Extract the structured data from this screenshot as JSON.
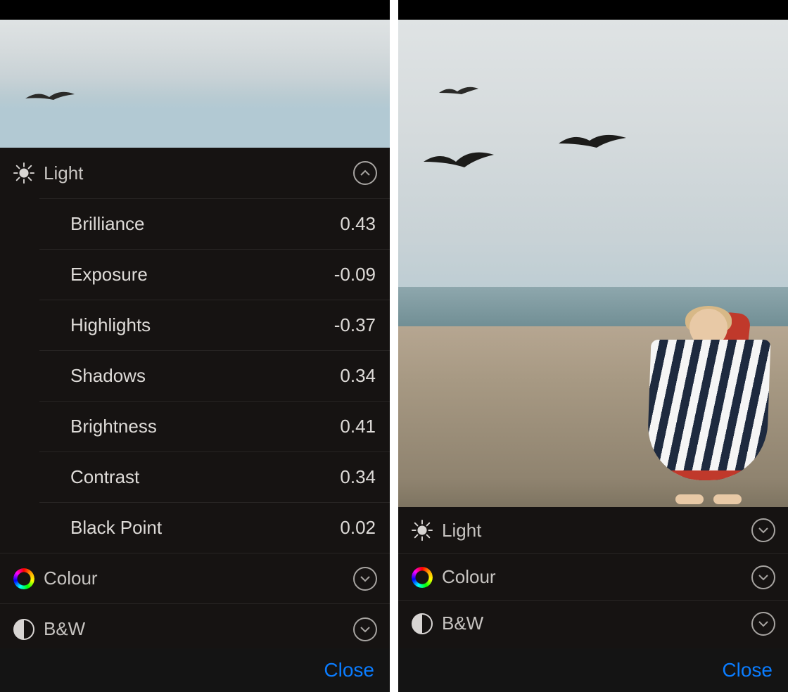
{
  "close_label": "Close",
  "categories": {
    "light": "Light",
    "colour": "Colour",
    "bw": "B&W"
  },
  "left": {
    "light_expanded": true,
    "adjustments": [
      {
        "name": "Brilliance",
        "value": "0.43"
      },
      {
        "name": "Exposure",
        "value": "-0.09"
      },
      {
        "name": "Highlights",
        "value": "-0.37"
      },
      {
        "name": "Shadows",
        "value": "0.34"
      },
      {
        "name": "Brightness",
        "value": "0.41"
      },
      {
        "name": "Contrast",
        "value": "0.34"
      },
      {
        "name": "Black Point",
        "value": "0.02"
      }
    ]
  },
  "right": {
    "light_expanded": false
  }
}
